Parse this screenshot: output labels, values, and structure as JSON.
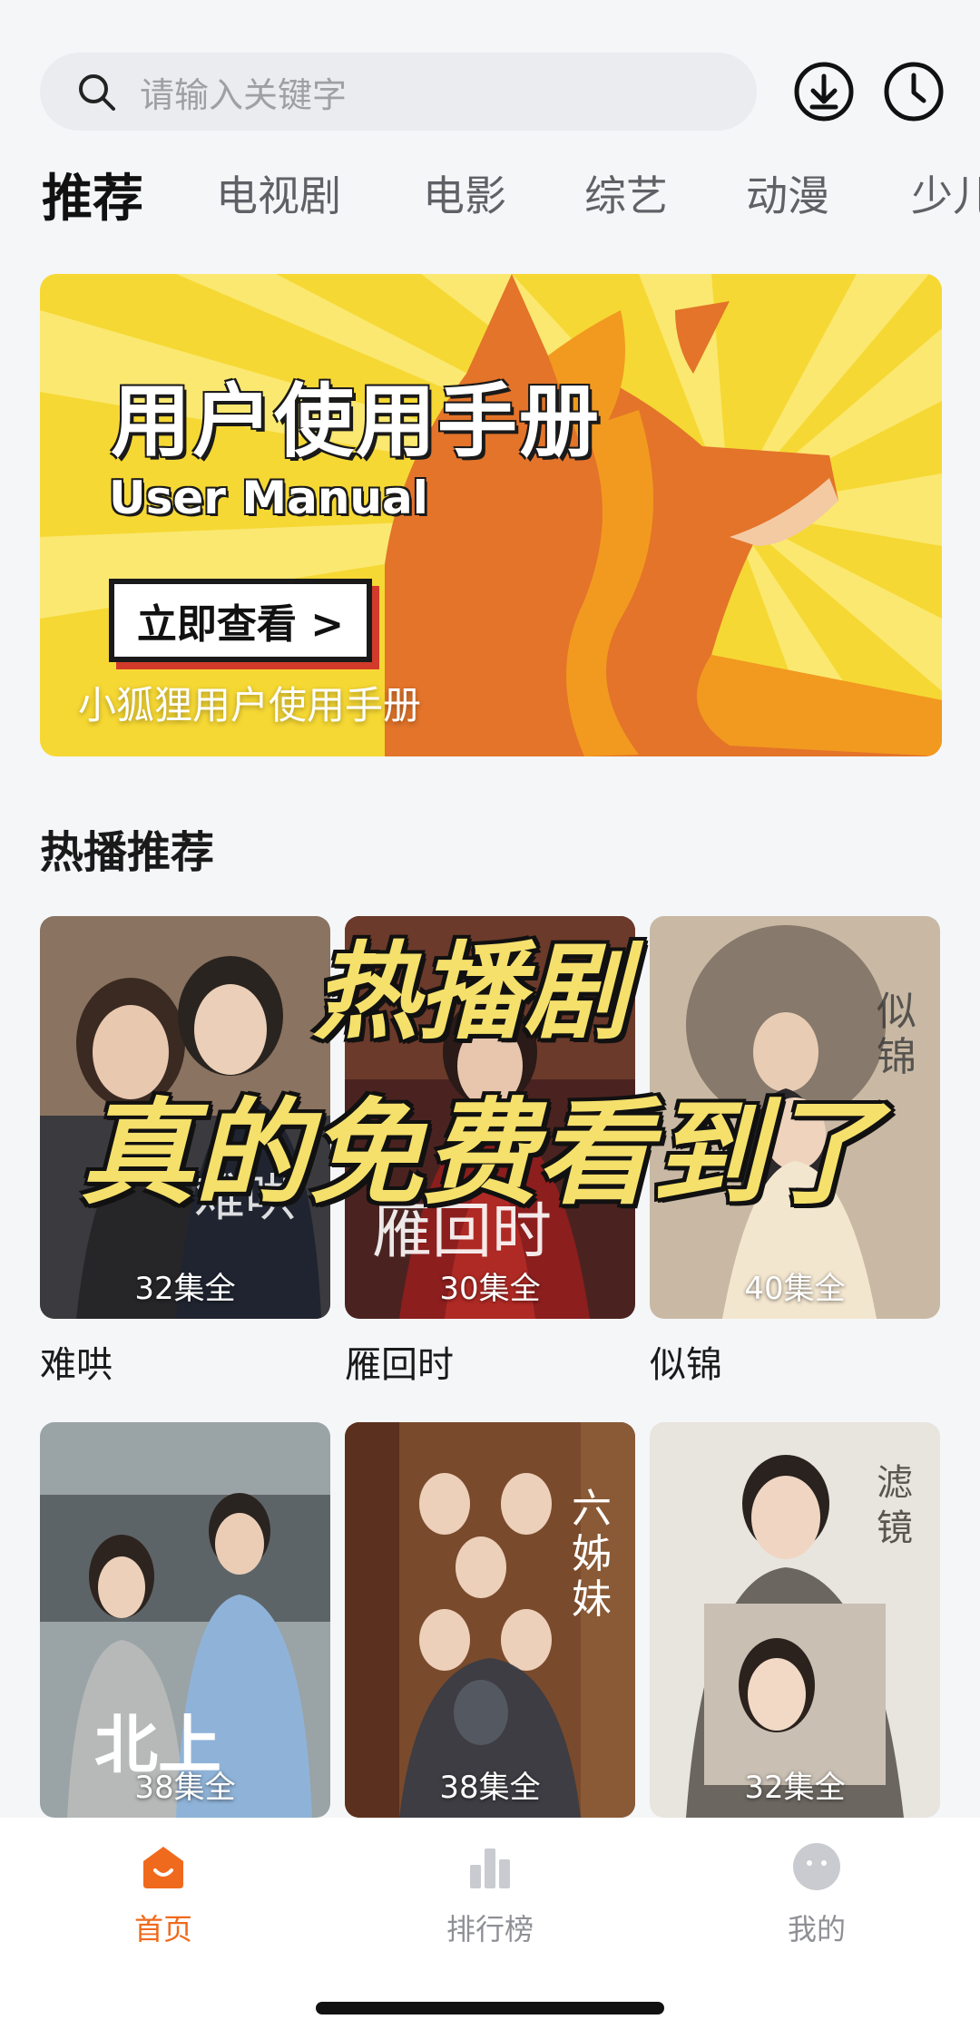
{
  "search": {
    "placeholder": "请输入关键字"
  },
  "header_icons": [
    "download-icon",
    "history-clock-icon"
  ],
  "tabs": [
    {
      "label": "推荐",
      "active": true
    },
    {
      "label": "电视剧"
    },
    {
      "label": "电影"
    },
    {
      "label": "综艺"
    },
    {
      "label": "动漫"
    },
    {
      "label": "少儿"
    }
  ],
  "banner": {
    "title": "用户使用手册",
    "subtitle": "User Manual",
    "button": "立即查看 >",
    "caption": "小狐狸用户使用手册"
  },
  "section": {
    "title": "热播推荐"
  },
  "overlay": {
    "line1": "热播剧",
    "line2": "真的免费看到了"
  },
  "posters": [
    {
      "title": "难哄",
      "episodes": "32集全"
    },
    {
      "title": "雁回时",
      "episodes": "30集全"
    },
    {
      "title": "似锦",
      "episodes": "40集全"
    },
    {
      "title": "",
      "episodes": "38集全"
    },
    {
      "title": "",
      "episodes": "38集全"
    },
    {
      "title": "",
      "episodes": "32集全"
    }
  ],
  "nav": [
    {
      "label": "首页",
      "icon": "home-icon",
      "active": true
    },
    {
      "label": "排行榜",
      "icon": "ranking-bars-icon"
    },
    {
      "label": "我的",
      "icon": "profile-face-icon"
    }
  ],
  "colors": {
    "accent": "#f06a1d",
    "overlay_text": "#f5e06c",
    "banner_bg": "#f6d834"
  }
}
